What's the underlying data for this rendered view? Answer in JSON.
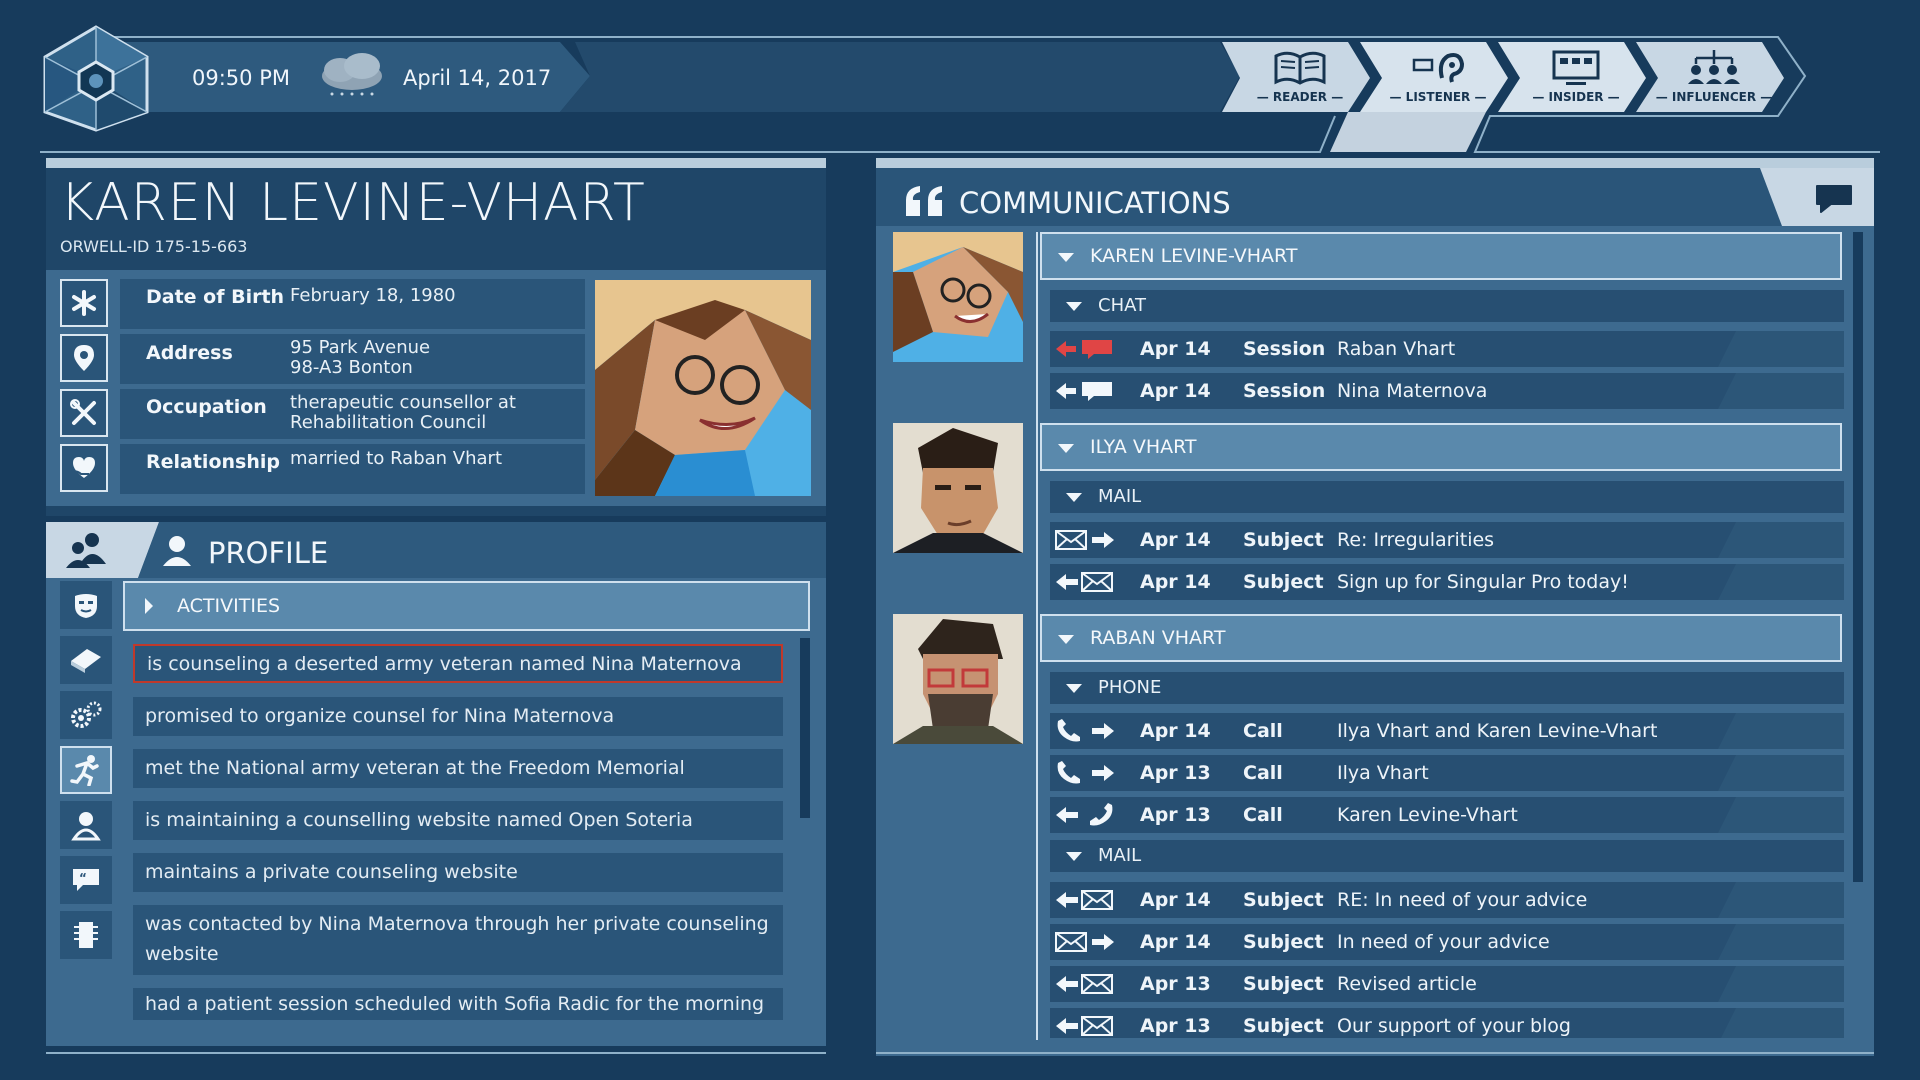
{
  "topbar": {
    "time": "09:50 PM",
    "date": "April 14, 2017",
    "roles": [
      {
        "label": "— READER —",
        "icon": "book-icon"
      },
      {
        "label": "— LISTENER —",
        "icon": "ear-icon"
      },
      {
        "label": "— INSIDER —",
        "icon": "monitor-icon"
      },
      {
        "label": "— INFLUENCER —",
        "icon": "network-icon"
      }
    ]
  },
  "person": {
    "name": "KAREN LEVINE-VHART",
    "orwell_id": "ORWELL-ID  175-15-663",
    "fields": [
      {
        "label": "Date of Birth",
        "value": "February 18, 1980",
        "value2": ""
      },
      {
        "label": "Address",
        "value": "95 Park Avenue",
        "value2": "98-A3 Bonton"
      },
      {
        "label": "Occupation",
        "value": "therapeutic counsellor at",
        "value2": "Rehabilitation Council"
      },
      {
        "label": "Relationship",
        "value": "married to Raban Vhart",
        "value2": ""
      }
    ]
  },
  "profile": {
    "title": "PROFILE",
    "section": "ACTIVITIES",
    "activities": [
      "is counseling a deserted army veteran named Nina Maternova",
      "promised to organize counsel for Nina Maternova",
      "met the National army veteran at the Freedom Memorial",
      "is maintaining a counselling website named Open Soteria",
      "maintains a private counseling website",
      "was contacted by Nina Maternova through her private counseling",
      "website",
      "had a patient session scheduled with Sofia Radic for the morning of"
    ]
  },
  "communications": {
    "title": "COMMUNICATIONS",
    "groups": [
      {
        "name": "KAREN LEVINE-VHART",
        "sections": [
          {
            "type": "CHAT",
            "items": [
              {
                "date": "Apr 14",
                "kind": "Session",
                "subject": "Raban Vhart"
              },
              {
                "date": "Apr 14",
                "kind": "Session",
                "subject": "Nina Maternova"
              }
            ]
          }
        ]
      },
      {
        "name": "ILYA VHART",
        "sections": [
          {
            "type": "MAIL",
            "items": [
              {
                "date": "Apr 14",
                "kind": "Subject",
                "subject": "Re: Irregularities"
              },
              {
                "date": "Apr 14",
                "kind": "Subject",
                "subject": "Sign up for Singular Pro today!"
              }
            ]
          }
        ]
      },
      {
        "name": "RABAN VHART",
        "sections": [
          {
            "type": "PHONE",
            "items": [
              {
                "date": "Apr 14",
                "kind": "Call",
                "subject": "Ilya Vhart and Karen Levine-Vhart"
              },
              {
                "date": "Apr 13",
                "kind": "Call",
                "subject": "Ilya Vhart"
              },
              {
                "date": "Apr 13",
                "kind": "Call",
                "subject": "Karen Levine-Vhart"
              }
            ]
          },
          {
            "type": "MAIL",
            "items": [
              {
                "date": "Apr 14",
                "kind": "Subject",
                "subject": "RE: In need of your advice"
              },
              {
                "date": "Apr 14",
                "kind": "Subject",
                "subject": "In need of your advice"
              },
              {
                "date": "Apr 13",
                "kind": "Subject",
                "subject": "Revised article"
              },
              {
                "date": "Apr 13",
                "kind": "Subject",
                "subject": "Our support of your blog"
              }
            ]
          }
        ]
      }
    ]
  },
  "colors": {
    "background": "#173b5c",
    "panel": "#2a5579",
    "highlight_border": "#c0392b",
    "accent_red": "#e04545"
  }
}
